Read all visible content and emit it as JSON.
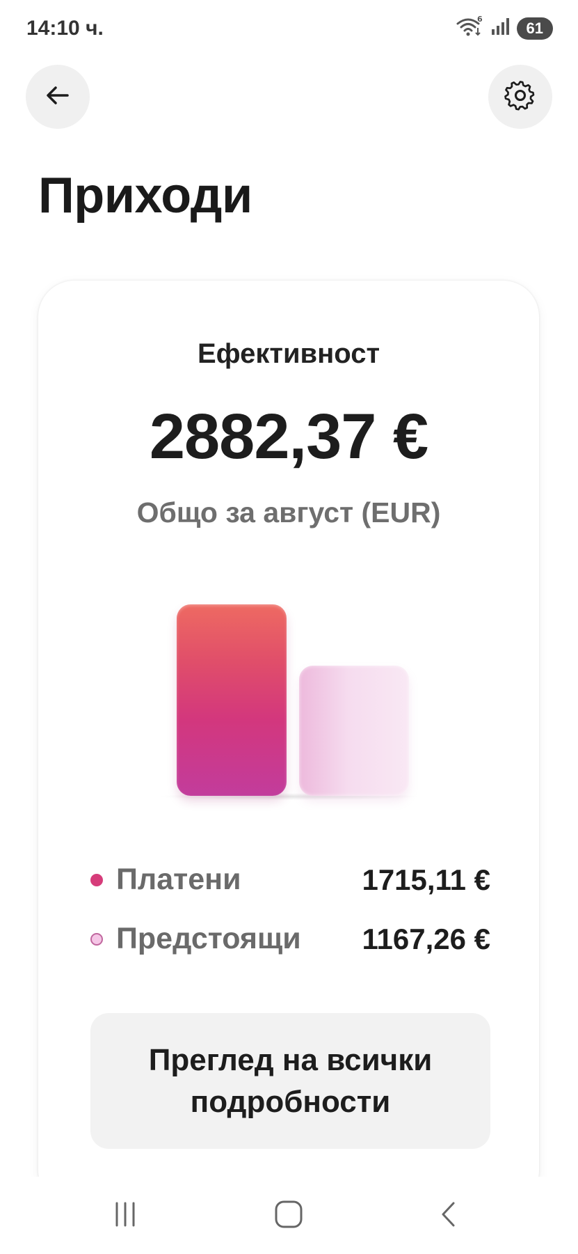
{
  "status_bar": {
    "time": "14:10 ч.",
    "battery": "61",
    "wifi_badge": "6"
  },
  "header": {
    "back_icon": "arrow-left-icon",
    "settings_icon": "gear-icon"
  },
  "page": {
    "title": "Приходи"
  },
  "card": {
    "title": "Ефективност",
    "total_amount": "2882,37 €",
    "total_caption": "Общо за август (EUR)",
    "legend": [
      {
        "label": "Платени",
        "value": "1715,11 €",
        "color": "#d63c7a"
      },
      {
        "label": "Предстоящи",
        "value": "1167,26 €",
        "color": "#f5c6e6"
      }
    ],
    "details_button": "Преглед на всички подробности"
  },
  "chart_data": {
    "type": "bar",
    "categories": [
      "Платени",
      "Предстоящи"
    ],
    "values": [
      1715.11,
      1167.26
    ],
    "colors": [
      "#d63c7a",
      "#f2cfe8"
    ],
    "grid": false
  },
  "nav_bar": {
    "icons": [
      "recent-apps-icon",
      "home-icon",
      "back-icon"
    ]
  }
}
